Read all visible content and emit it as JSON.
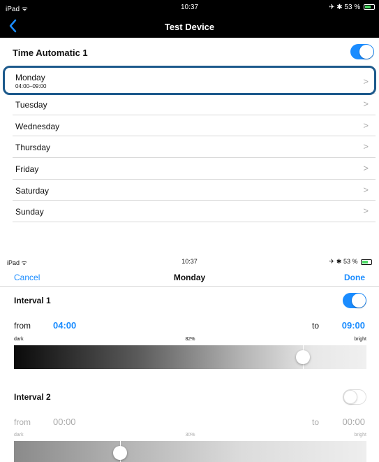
{
  "top_status": {
    "device": "iPad ᯤ",
    "time": "10:37",
    "right": "✈ ✱ 53 %"
  },
  "top_nav": {
    "back_icon": "chevron-left-icon",
    "title": "Test Device"
  },
  "schedule": {
    "title": "Time Automatic 1",
    "enabled": true
  },
  "days": [
    {
      "name": "Monday",
      "sub": "04:00–09:00"
    },
    {
      "name": "Tuesday"
    },
    {
      "name": "Wednesday"
    },
    {
      "name": "Thursday"
    },
    {
      "name": "Friday"
    },
    {
      "name": "Saturday"
    },
    {
      "name": "Sunday"
    }
  ],
  "bottom_status": {
    "device": "iPad ᯤ",
    "time": "10:37",
    "right": "✈ ✱ 53 %"
  },
  "modal": {
    "cancel": "Cancel",
    "title": "Monday",
    "done": "Done"
  },
  "intervals": [
    {
      "title": "Interval 1",
      "enabled": true,
      "from_label": "from",
      "from": "04:00",
      "to_label": "to",
      "to": "09:00",
      "dark_label": "dark",
      "brightness": "82%",
      "brightness_value": 0.82,
      "bright_label": "bright"
    },
    {
      "title": "Interval 2",
      "enabled": false,
      "from_label": "from",
      "from": "00:00",
      "to_label": "to",
      "to": "00:00",
      "dark_label": "dark",
      "brightness": "30%",
      "brightness_value": 0.3,
      "bright_label": "bright"
    }
  ],
  "colors": {
    "accent": "#1a8cff",
    "highlight": "#1d5a8c"
  }
}
